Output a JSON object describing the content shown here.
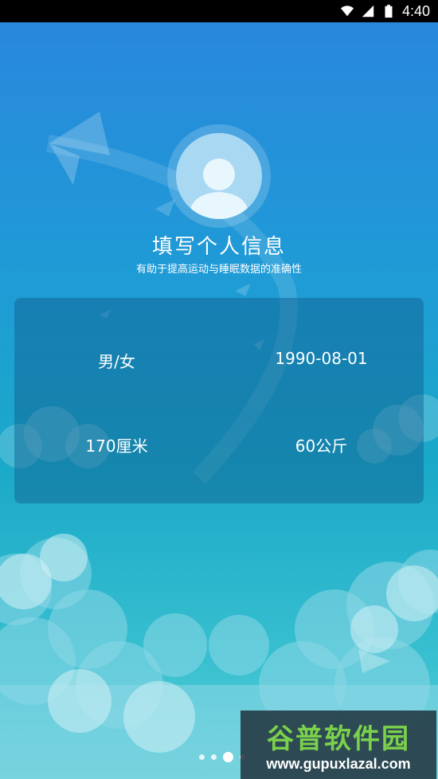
{
  "status_bar": {
    "time": "4:40",
    "icons": [
      "wifi-icon",
      "signal-icon",
      "battery-icon"
    ]
  },
  "profile": {
    "title": "填写个人信息",
    "subtitle": "有助于提高运动与睡眠数据的准确性"
  },
  "info": {
    "gender": "男/女",
    "birthday": "1990-08-01",
    "height": "170厘米",
    "weight": "60公斤"
  },
  "pager": {
    "count": 4,
    "active_index": 2
  },
  "watermark": {
    "cn": "谷普软件园",
    "en": "www.gupuxlazal.com"
  },
  "colors": {
    "bg_top": "#2a86dd",
    "bg_bottom": "#5fd0d6",
    "panel": "#0f5a8c"
  }
}
